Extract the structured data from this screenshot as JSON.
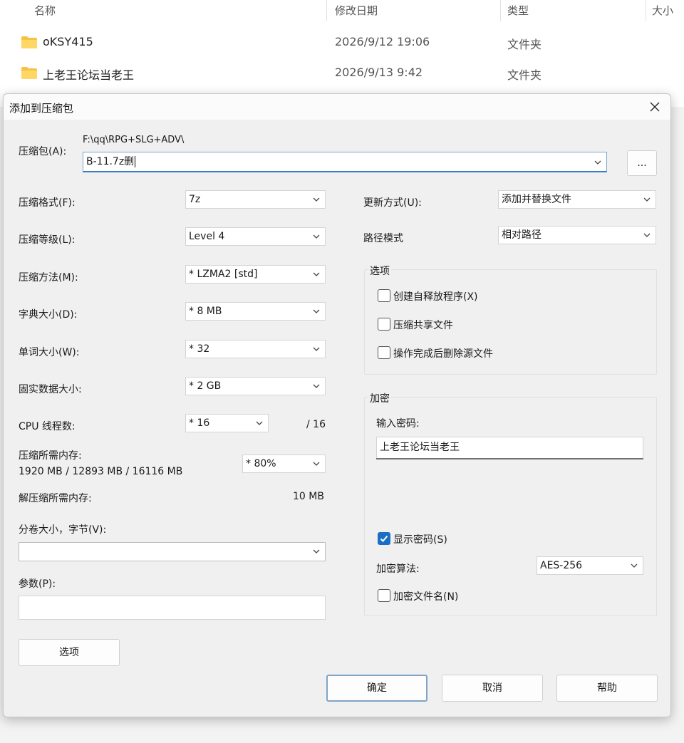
{
  "explorer": {
    "columns": {
      "name": "名称",
      "date": "修改日期",
      "type": "类型",
      "size": "大小"
    },
    "rows": [
      {
        "name": "oKSY415",
        "date": "2026/9/12 19:06",
        "type": "文件夹"
      },
      {
        "name": "上老王论坛当老王",
        "date": "2026/9/13 9:42",
        "type": "文件夹"
      }
    ]
  },
  "dialog": {
    "title": "添加到压缩包",
    "archive": {
      "label": "压缩包(A):",
      "path": "F:\\qq\\RPG+SLG+ADV\\",
      "value": "B-11.7z删",
      "browse_label": "..."
    },
    "left": {
      "format": {
        "label": "压缩格式(F):",
        "value": "7z"
      },
      "level": {
        "label": "压缩等级(L):",
        "value": "Level 4"
      },
      "method": {
        "label": "压缩方法(M):",
        "value": "*  LZMA2 [std]"
      },
      "dict": {
        "label": "字典大小(D):",
        "value": "*  8 MB"
      },
      "word": {
        "label": "单词大小(W):",
        "value": "*  32"
      },
      "solid": {
        "label": "固实数据大小:",
        "value": "*  2 GB"
      },
      "cpu": {
        "label": "CPU 线程数:",
        "value": "*  16",
        "max": "/ 16"
      },
      "mem_compress": {
        "label": "压缩所需内存:",
        "detail": "1920 MB / 12893 MB / 16116 MB",
        "value": "* 80%"
      },
      "mem_decompress": {
        "label": "解压缩所需内存:",
        "value": "10 MB"
      },
      "volume": {
        "label": "分卷大小，字节(V):",
        "value": ""
      },
      "params": {
        "label": "参数(P):",
        "value": ""
      },
      "options_button": "选项"
    },
    "right": {
      "update": {
        "label": "更新方式(U):",
        "value": "添加并替换文件"
      },
      "path_mode": {
        "label": "路径模式",
        "value": "相对路径"
      },
      "options": {
        "title": "选项",
        "sfx": "创建自释放程序(X)",
        "shared": "压缩共享文件",
        "delete": "操作完成后删除源文件"
      },
      "encryption": {
        "title": "加密",
        "password_label": "输入密码:",
        "password_value": "上老王论坛当老王",
        "show_password": "显示密码(S)",
        "algo_label": "加密算法:",
        "algo_value": "AES-256",
        "encrypt_names": "加密文件名(N)"
      }
    },
    "buttons": {
      "ok": "确定",
      "cancel": "取消",
      "help": "帮助"
    }
  }
}
